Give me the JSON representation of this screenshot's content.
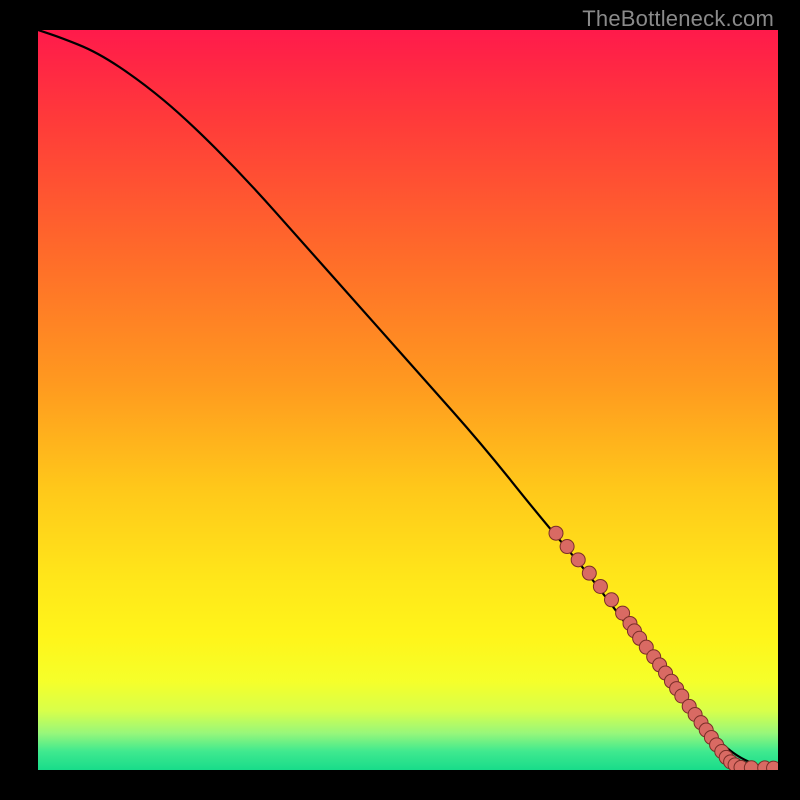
{
  "watermark": "TheBottleneck.com",
  "colors": {
    "bg": "#000000",
    "gradient_stops": [
      {
        "offset": 0.0,
        "color": "#ff1a4b"
      },
      {
        "offset": 0.12,
        "color": "#ff3a3a"
      },
      {
        "offset": 0.3,
        "color": "#ff6a2a"
      },
      {
        "offset": 0.48,
        "color": "#ff9a1f"
      },
      {
        "offset": 0.62,
        "color": "#ffc81a"
      },
      {
        "offset": 0.74,
        "color": "#ffe61a"
      },
      {
        "offset": 0.82,
        "color": "#fff51a"
      },
      {
        "offset": 0.88,
        "color": "#f5ff2a"
      },
      {
        "offset": 0.92,
        "color": "#d8ff4a"
      },
      {
        "offset": 0.95,
        "color": "#98f77a"
      },
      {
        "offset": 0.975,
        "color": "#3fe98f"
      },
      {
        "offset": 1.0,
        "color": "#18dc8a"
      }
    ],
    "curve": "#000000",
    "marker_fill": "#d96a63",
    "marker_stroke": "#7a2e28"
  },
  "chart_data": {
    "type": "line",
    "title": "",
    "xlabel": "",
    "ylabel": "",
    "xlim": [
      0,
      100
    ],
    "ylim": [
      0,
      100
    ],
    "grid": false,
    "legend": false,
    "series": [
      {
        "name": "curve",
        "x": [
          0,
          3,
          8,
          14,
          20,
          28,
          36,
          44,
          52,
          60,
          68,
          74,
          80,
          86,
          90,
          94,
          98,
          100
        ],
        "y": [
          100,
          99,
          97,
          93,
          88,
          80,
          71,
          62,
          53,
          44,
          34,
          27,
          19,
          11,
          6,
          2,
          0.3,
          0.2
        ]
      }
    ],
    "markers": {
      "name": "highlight-points",
      "x": [
        70,
        71.5,
        73,
        74.5,
        76,
        77.5,
        79,
        80,
        80.6,
        81.3,
        82.2,
        83.2,
        84,
        84.8,
        85.6,
        86.3,
        87,
        88,
        88.8,
        89.6,
        90.3,
        91,
        91.7,
        92.4,
        93,
        93.6,
        94.2,
        95,
        96.4,
        98.2,
        99.4
      ],
      "y": [
        32,
        30.2,
        28.4,
        26.6,
        24.8,
        23,
        21.2,
        19.8,
        18.8,
        17.8,
        16.6,
        15.3,
        14.2,
        13.1,
        12,
        11,
        10,
        8.6,
        7.5,
        6.4,
        5.4,
        4.4,
        3.4,
        2.5,
        1.7,
        1.1,
        0.7,
        0.35,
        0.3,
        0.28,
        0.26
      ]
    }
  }
}
